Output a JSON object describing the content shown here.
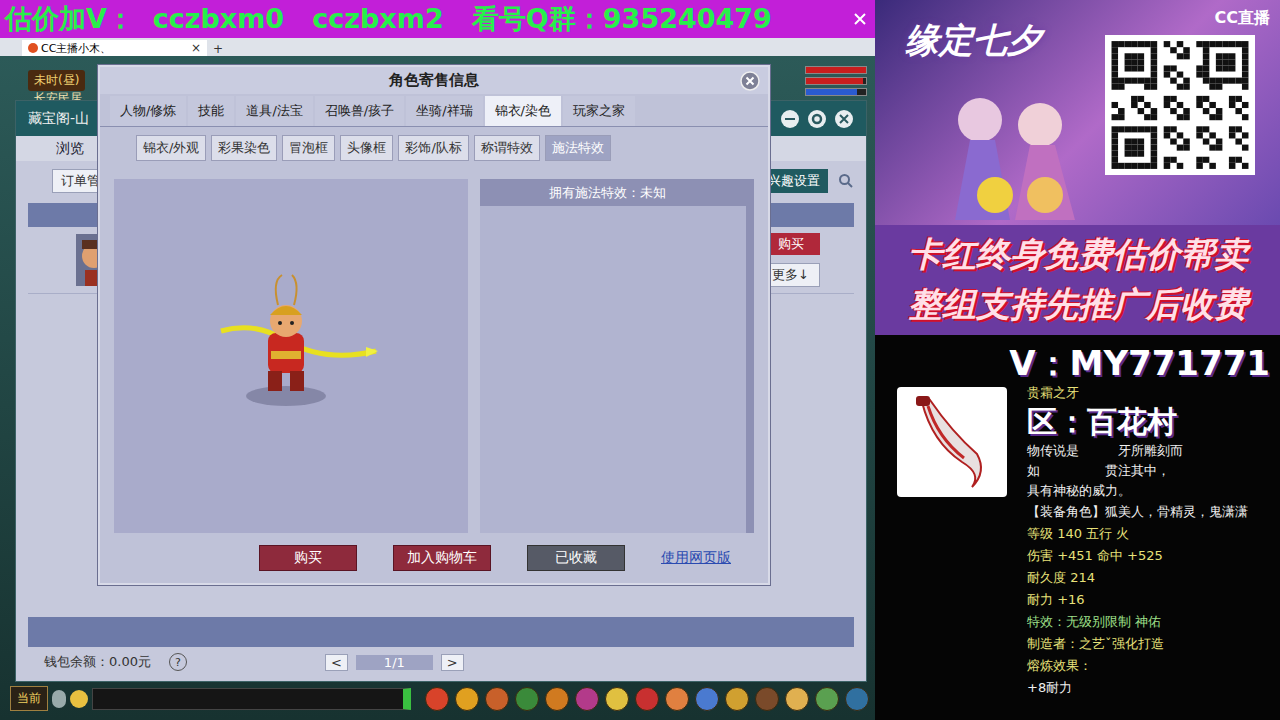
{
  "stream_banner": {
    "text": "估价加V：  cczbxm0   cczbxm2   看号Q群：935240479"
  },
  "browser_tab": {
    "title": "CC主播小木、",
    "close": "×",
    "new_tab": "+"
  },
  "hud": {
    "time": "未时(昼)",
    "location": "长安民居",
    "bars": [
      {
        "level": 1.0,
        "color": "#c81e1e"
      },
      {
        "level": 0.95,
        "color": "#c81e1e"
      },
      {
        "level": 0.85,
        "color": "#2a5bd0"
      }
    ]
  },
  "cbg_window": {
    "title": "藏宝阁-山",
    "tab": "浏览",
    "order_button": "订单管",
    "interest_button": "兴趣设置",
    "buy": "购买",
    "more": "更多↓",
    "wallet": "钱包余额：0.00元",
    "help": "?",
    "pager": {
      "prev": "<",
      "page": "1/1",
      "next": ">"
    }
  },
  "dialog": {
    "title": "角色寄售信息",
    "tabs": [
      {
        "label": "人物/修炼",
        "selected": false
      },
      {
        "label": "技能",
        "selected": false
      },
      {
        "label": "道具/法宝",
        "selected": false
      },
      {
        "label": "召唤兽/孩子",
        "selected": false
      },
      {
        "label": "坐骑/祥瑞",
        "selected": false
      },
      {
        "label": "锦衣/染色",
        "selected": true
      },
      {
        "label": "玩家之家",
        "selected": false
      }
    ],
    "subtabs": [
      {
        "label": "锦衣/外观",
        "selected": false
      },
      {
        "label": "彩果染色",
        "selected": false
      },
      {
        "label": "冒泡框",
        "selected": false
      },
      {
        "label": "头像框",
        "selected": false
      },
      {
        "label": "彩饰/队标",
        "selected": false
      },
      {
        "label": "称谓特效",
        "selected": false
      },
      {
        "label": "施法特效",
        "selected": true
      }
    ],
    "effects_header": "拥有施法特效：未知",
    "buttons": [
      {
        "label": "购买",
        "kind": "primary"
      },
      {
        "label": "加入购物车",
        "kind": "primary"
      },
      {
        "label": "已收藏",
        "kind": "muted"
      },
      {
        "label": "使用网页版",
        "kind": "link"
      }
    ]
  },
  "chat_bar": {
    "channel": "当前"
  },
  "ad": {
    "title": "缘定七夕",
    "brand": "CC直播"
  },
  "promo_lines": [
    "卡红终身免费估价帮卖",
    "整组支持先推广后收费"
  ],
  "contact": "V：MY771771",
  "item": {
    "name": "贵霜之牙",
    "region": "区：百花村",
    "description": [
      "物传说是　　　牙所雕刻而",
      "如　　　　　贯注其中，",
      "具有神秘的威力。"
    ],
    "stats": [
      {
        "text": "【装备角色】狐美人，骨精灵，鬼潇潇",
        "color": "#f0f0f0"
      },
      {
        "text": "等级 140 五行 火",
        "color": "#e8e27a"
      },
      {
        "text": "伤害 +451 命中 +525",
        "color": "#e8e27a"
      },
      {
        "text": "耐久度 214",
        "color": "#e8e27a"
      },
      {
        "text": "耐力 +16",
        "color": "#e8e27a"
      },
      {
        "text": "特效：无级别限制 神佑",
        "color": "#9fe08a"
      },
      {
        "text": "制造者：之艺ˇ强化打造",
        "color": "#e8e27a"
      },
      {
        "text": "熔炼效果：",
        "color": "#e8e27a"
      },
      {
        "text": "+8耐力",
        "color": "#f0f0f0"
      }
    ]
  }
}
